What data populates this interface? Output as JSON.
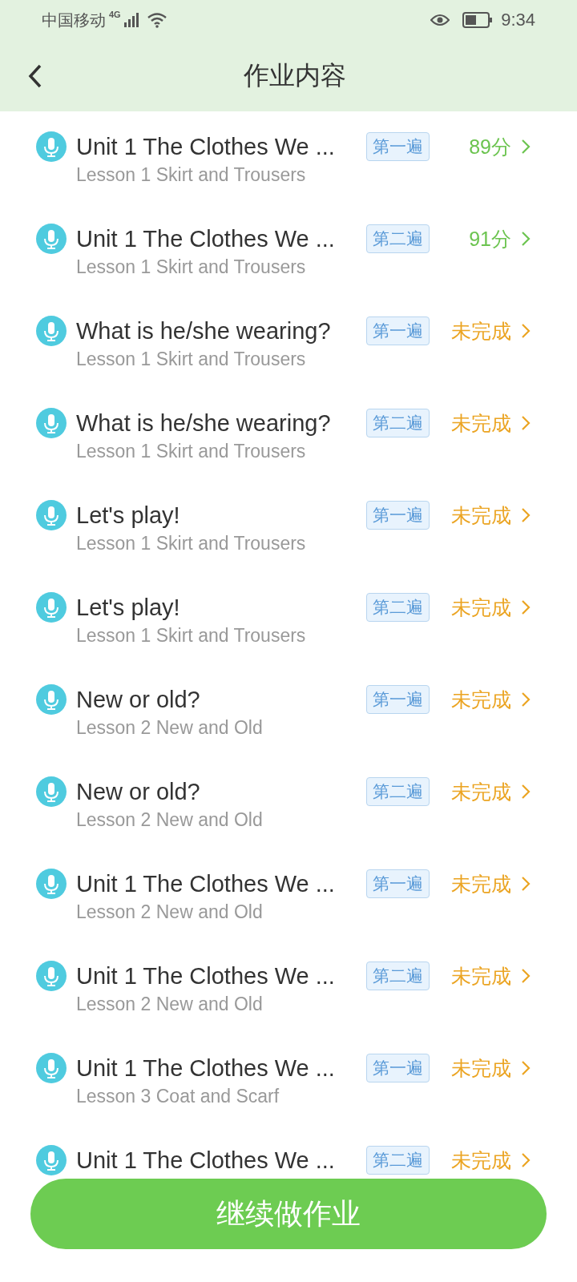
{
  "status_bar": {
    "carrier": "中国移动",
    "network": "4G",
    "time": "9:34"
  },
  "header": {
    "title": "作业内容"
  },
  "items": [
    {
      "title": "Unit 1 The Clothes We ...",
      "subtitle": "Lesson 1 Skirt and Trousers",
      "tag": "第一遍",
      "status": {
        "kind": "score",
        "text": "89分"
      }
    },
    {
      "title": "Unit 1 The Clothes We ...",
      "subtitle": "Lesson 1 Skirt and Trousers",
      "tag": "第二遍",
      "status": {
        "kind": "score",
        "text": "91分"
      }
    },
    {
      "title": "What is he/she wearing?",
      "subtitle": "Lesson 1 Skirt and Trousers",
      "tag": "第一遍",
      "status": {
        "kind": "incomplete",
        "text": "未完成"
      }
    },
    {
      "title": "What is he/she wearing?",
      "subtitle": "Lesson 1 Skirt and Trousers",
      "tag": "第二遍",
      "status": {
        "kind": "incomplete",
        "text": "未完成"
      }
    },
    {
      "title": "Let's play!",
      "subtitle": "Lesson 1 Skirt and Trousers",
      "tag": "第一遍",
      "status": {
        "kind": "incomplete",
        "text": "未完成"
      }
    },
    {
      "title": "Let's play!",
      "subtitle": "Lesson 1 Skirt and Trousers",
      "tag": "第二遍",
      "status": {
        "kind": "incomplete",
        "text": "未完成"
      }
    },
    {
      "title": "New or old?",
      "subtitle": "Lesson 2 New and Old",
      "tag": "第一遍",
      "status": {
        "kind": "incomplete",
        "text": "未完成"
      }
    },
    {
      "title": "New or old?",
      "subtitle": "Lesson 2 New and Old",
      "tag": "第二遍",
      "status": {
        "kind": "incomplete",
        "text": "未完成"
      }
    },
    {
      "title": "Unit 1 The Clothes We ...",
      "subtitle": "Lesson 2 New and Old",
      "tag": "第一遍",
      "status": {
        "kind": "incomplete",
        "text": "未完成"
      }
    },
    {
      "title": "Unit 1 The Clothes We ...",
      "subtitle": "Lesson 2 New and Old",
      "tag": "第二遍",
      "status": {
        "kind": "incomplete",
        "text": "未完成"
      }
    },
    {
      "title": "Unit 1 The Clothes We ...",
      "subtitle": "Lesson 3 Coat and Scarf",
      "tag": "第一遍",
      "status": {
        "kind": "incomplete",
        "text": "未完成"
      }
    },
    {
      "title": "Unit 1 The Clothes We ...",
      "tag": "第二遍",
      "status": {
        "kind": "incomplete",
        "text": "未完成"
      }
    }
  ],
  "button": {
    "label": "继续做作业"
  }
}
